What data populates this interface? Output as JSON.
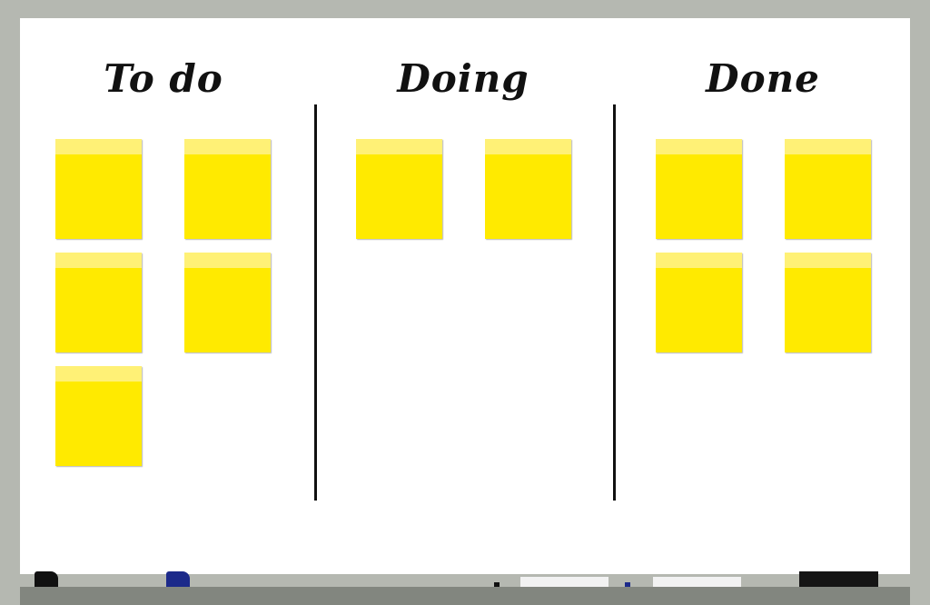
{
  "board": {
    "columns": [
      {
        "id": "todo",
        "heading": "To do",
        "note_count": 5
      },
      {
        "id": "doing",
        "heading": "Doing",
        "note_count": 2
      },
      {
        "id": "done",
        "heading": "Done",
        "note_count": 4
      }
    ]
  },
  "colors": {
    "frame": "#b5b8b1",
    "surface": "#ffffff",
    "note": "#ffea00",
    "note_tape": "#fff176",
    "ink": "#111111",
    "blue_marker": "#1c2a8a"
  },
  "tray_items": [
    "black-marker-icon",
    "blue-marker-icon",
    "eraser-icon",
    "eraser-icon",
    "black-marker-icon"
  ]
}
